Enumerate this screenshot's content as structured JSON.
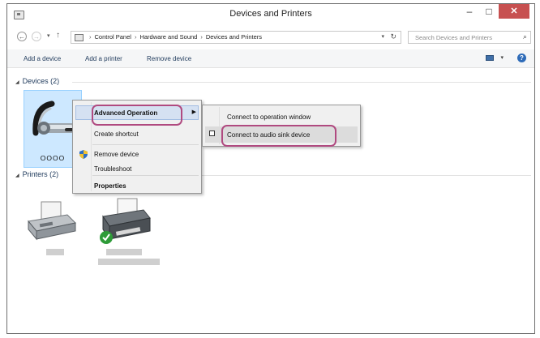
{
  "window": {
    "title": "Devices and Printers"
  },
  "titlebar": {
    "minimize": "–",
    "maximize": "□",
    "close": "✕"
  },
  "address": {
    "breadcrumbs": [
      "Control Panel",
      "Hardware and Sound",
      "Devices and Printers"
    ],
    "search_placeholder": "Search Devices and Printers"
  },
  "commandbar": {
    "add_device": "Add a device",
    "add_printer": "Add a printer",
    "remove_device": "Remove device"
  },
  "groups": {
    "devices": "Devices (2)",
    "printers": "Printers (2)"
  },
  "device": {
    "label": "OOOO"
  },
  "context_menu": {
    "advanced_operation": "Advanced Operation",
    "create_shortcut": "Create shortcut",
    "remove_device": "Remove device",
    "troubleshoot": "Troubleshoot",
    "properties": "Properties"
  },
  "submenu": {
    "connect_window": "Connect to operation window",
    "connect_sink": "Connect to audio sink device"
  },
  "colors": {
    "callout": "#b04a80",
    "selection": "#cde8ff",
    "close_button": "#c75050",
    "link_text": "#1e395b"
  }
}
